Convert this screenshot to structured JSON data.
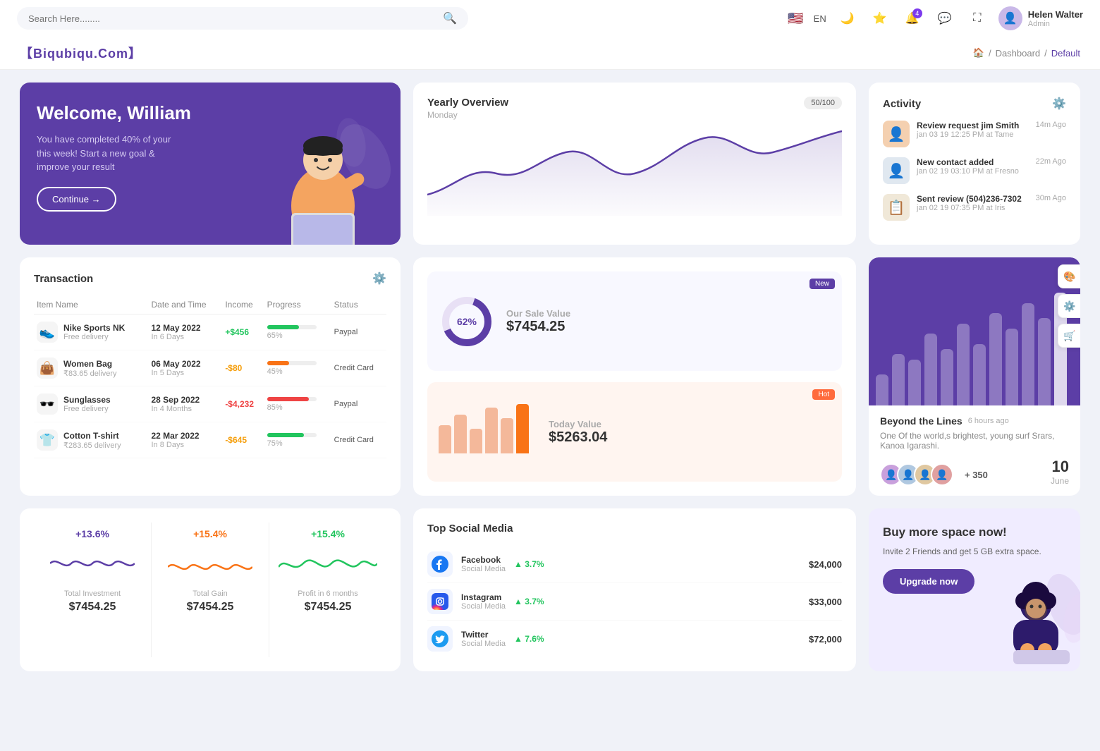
{
  "topNav": {
    "searchPlaceholder": "Search Here........",
    "lang": "EN",
    "userName": "Helen Walter",
    "userRole": "Admin",
    "notificationCount": "4"
  },
  "breadcrumb": {
    "brand": "【Biqubiqu.Com】",
    "home": "Home",
    "dashboard": "Dashboard",
    "current": "Default"
  },
  "welcome": {
    "title": "Welcome, William",
    "subtitle": "You have completed 40% of your this week! Start a new goal & improve your result",
    "buttonLabel": "Continue →"
  },
  "yearlyOverview": {
    "title": "Yearly Overview",
    "subtitle": "Monday",
    "badge": "50/100"
  },
  "activity": {
    "title": "Activity",
    "items": [
      {
        "title": "Review request jim Smith",
        "sub": "jan 03 19 12:25 PM at Tame",
        "time": "14m Ago"
      },
      {
        "title": "New contact added",
        "sub": "jan 02 19 03:10 PM at Fresno",
        "time": "22m Ago"
      },
      {
        "title": "Sent review (504)236-7302",
        "sub": "jan 02 19 07:35 PM at Iris",
        "time": "30m Ago"
      }
    ]
  },
  "transaction": {
    "title": "Transaction",
    "columns": [
      "Item Name",
      "Date and Time",
      "Income",
      "Progress",
      "Status"
    ],
    "rows": [
      {
        "name": "Nike Sports NK",
        "sub": "Free delivery",
        "date": "12 May 2022",
        "dateSub": "In 6 Days",
        "income": "+$456",
        "incomeType": "pos",
        "progress": 65,
        "progressColor": "#22c55e",
        "status": "Paypal",
        "icon": "👟"
      },
      {
        "name": "Women Bag",
        "sub": "₹83.65 delivery",
        "date": "06 May 2022",
        "dateSub": "In 5 Days",
        "income": "-$80",
        "incomeType": "neg",
        "progress": 45,
        "progressColor": "#f97316",
        "status": "Credit Card",
        "icon": "👜"
      },
      {
        "name": "Sunglasses",
        "sub": "Free delivery",
        "date": "28 Sep 2022",
        "dateSub": "In 4 Months",
        "income": "-$4,232",
        "incomeType": "neg2",
        "progress": 85,
        "progressColor": "#ef4444",
        "status": "Paypal",
        "icon": "🕶️"
      },
      {
        "name": "Cotton T-shirt",
        "sub": "₹283.65 delivery",
        "date": "22 Mar 2022",
        "dateSub": "In 8 Days",
        "income": "-$645",
        "incomeType": "neg",
        "progress": 75,
        "progressColor": "#22c55e",
        "status": "Credit Card",
        "icon": "👕"
      }
    ]
  },
  "saleValue": {
    "donutPercent": "62%",
    "donutValue": "$7454.25",
    "donutLabel": "Our Sale Value",
    "newBadge": "New",
    "todayLabel": "Today Value",
    "todayValue": "$5263.04",
    "hotBadge": "Hot",
    "bars": [
      40,
      55,
      35,
      65,
      50,
      70
    ]
  },
  "beyondLines": {
    "title": "Beyond the Lines",
    "timeAgo": "6 hours ago",
    "desc": "One Of the world,s brightest, young surf Srars, Kanoa Igarashi.",
    "plusCount": "+ 350",
    "dateNum": "10",
    "dateMonth": "June",
    "bars": [
      30,
      50,
      45,
      70,
      55,
      80,
      60,
      90,
      75,
      100,
      85,
      110
    ]
  },
  "stats": [
    {
      "percent": "+13.6%",
      "label": "Total Investment",
      "value": "$7454.25",
      "color": "purple"
    },
    {
      "percent": "+15.4%",
      "label": "Total Gain",
      "value": "$7454.25",
      "color": "orange"
    },
    {
      "percent": "+15.4%",
      "label": "Profit in 6 months",
      "value": "$7454.25",
      "color": "green"
    }
  ],
  "socialMedia": {
    "title": "Top Social Media",
    "items": [
      {
        "name": "Facebook",
        "sub": "Social Media",
        "growth": "3.7%",
        "amount": "$24,000",
        "icon": "f",
        "color": "#1877f2"
      },
      {
        "name": "Instagram",
        "sub": "Social Media",
        "growth": "3.7%",
        "amount": "$33,000",
        "icon": "in",
        "color": "#e1306c"
      },
      {
        "name": "Twitter",
        "sub": "Social Media",
        "growth": "7.6%",
        "amount": "$72,000",
        "icon": "t",
        "color": "#1d9bf0"
      }
    ]
  },
  "buySpace": {
    "title": "Buy more space now!",
    "desc": "Invite 2 Friends and get 5 GB extra space.",
    "buttonLabel": "Upgrade now"
  }
}
